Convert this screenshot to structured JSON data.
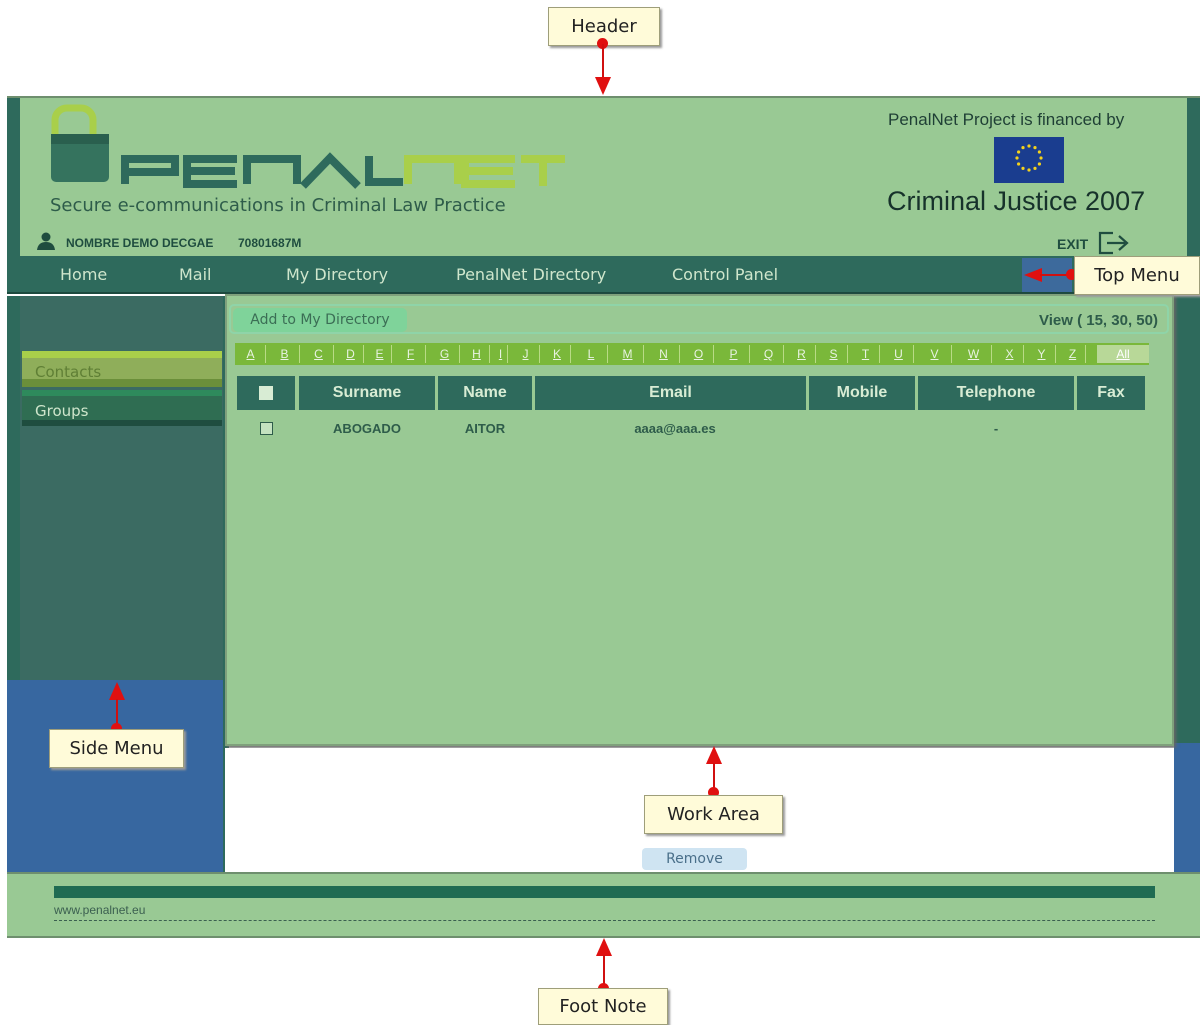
{
  "callouts": {
    "header": "Header",
    "top_menu": "Top Menu",
    "side_menu": "Side Menu",
    "work_area": "Work Area",
    "foot_note": "Foot Note"
  },
  "header": {
    "tagline": "Secure e-communications in Criminal Law Practice",
    "user_name": "NOMBRE DEMO DECGAE",
    "user_id": "70801687M",
    "financed_by": "PenalNet Project is financed by",
    "program": "Criminal Justice 2007",
    "exit_label": "EXIT"
  },
  "top_menu": [
    "Home",
    "Mail",
    "My Directory",
    "PenalNet Directory",
    "Control Panel"
  ],
  "side_menu": [
    "Contacts",
    "Groups"
  ],
  "work_area": {
    "add_button": "Add to My Directory",
    "view_options": "View ( 15, 30, 50)",
    "letters": [
      "A",
      "B",
      "C",
      "D",
      "E",
      "F",
      "G",
      "H",
      "I",
      "J",
      "K",
      "L",
      "M",
      "N",
      "O",
      "P",
      "Q",
      "R",
      "S",
      "T",
      "U",
      "V",
      "W",
      "X",
      "Y",
      "Z"
    ],
    "all_label": "All",
    "columns": [
      "Surname",
      "Name",
      "Email",
      "Mobile",
      "Telephone",
      "Fax"
    ],
    "rows": [
      {
        "surname": "ABOGADO",
        "name": "AITOR",
        "email": "aaaa@aaa.es",
        "mobile": "",
        "telephone": "-",
        "fax": ""
      }
    ],
    "remove_button": "Remove"
  },
  "footer": {
    "website": "www.penalnet.eu"
  },
  "colors": {
    "panel_green": "#99c994",
    "dark_teal": "#2e6a5c",
    "blue": "#3767a0",
    "callout_red": "#e01010"
  }
}
